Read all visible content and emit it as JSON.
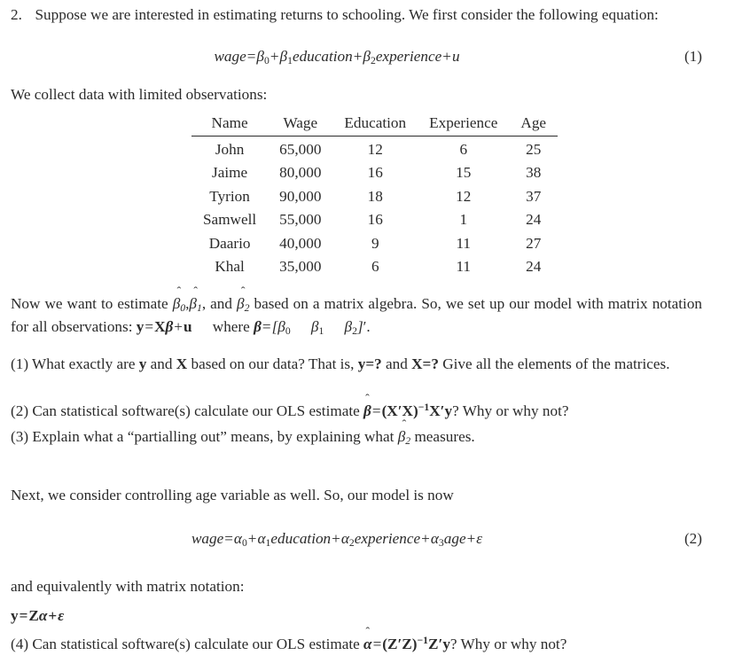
{
  "document": {
    "problem_number": "2.",
    "intro_paragraph": "Suppose we are interested in estimating returns to schooling. We first consider the following equation:",
    "collect_data_line": "We collect data with limited observations:",
    "matrix_paragraph_pre": "Now we want to estimate",
    "matrix_paragraph_mid": ", and",
    "matrix_paragraph_post": "based on a matrix algebra. So, we set up our model with matrix notation for all observations:",
    "where_label": "where",
    "next_section_line": "Next, we consider controlling age variable as well. So, our model is now",
    "matrix_notation_line": "and equivalently with matrix notation:"
  },
  "equations": {
    "eq1": {
      "number": "(1)",
      "lhs": "wage",
      "equals": "=",
      "terms": [
        "β",
        "0",
        "β",
        "1",
        "education",
        "β",
        "2",
        "experience",
        "u"
      ],
      "plain": "wage = β0 + β1education + β2experience + u"
    },
    "eq2": {
      "number": "(2)",
      "lhs": "wage",
      "equals": "=",
      "plain": "wage = α0 + α1education + α2experience + α3age + ε"
    },
    "model_matrix": {
      "plain": "y = Xβ + u",
      "beta_def": "β=[β0 β1 β2]′"
    },
    "model_matrix_z": {
      "plain": "y = Zα + ε"
    }
  },
  "table": {
    "columns": [
      "Name",
      "Wage",
      "Education",
      "Experience",
      "Age"
    ],
    "rows": [
      {
        "name": "John",
        "wage": "65,000",
        "education": "12",
        "experience": "6",
        "age": "25"
      },
      {
        "name": "Jaime",
        "wage": "80,000",
        "education": "16",
        "experience": "15",
        "age": "38"
      },
      {
        "name": "Tyrion",
        "wage": "90,000",
        "education": "18",
        "experience": "12",
        "age": "37"
      },
      {
        "name": "Samwell",
        "wage": "55,000",
        "education": "16",
        "experience": "1",
        "age": "24"
      },
      {
        "name": "Daario",
        "wage": "40,000",
        "education": "9",
        "experience": "11",
        "age": "27"
      },
      {
        "name": "Khal",
        "wage": "35,000",
        "education": "6",
        "experience": "11",
        "age": "24"
      }
    ]
  },
  "questions": [
    {
      "label": "(1)",
      "text_a": "What exactly are",
      "text_b": "and",
      "text_c": "based on our data? That is,",
      "text_d": "y=?",
      "text_e": "and",
      "text_f": "X=?",
      "text_g": "Give all the elements of the matrices.",
      "plain": "(1) What exactly are y and X based on our data? That is, y=? and X=? Give all the elements of the matrices."
    },
    {
      "label": "(2)",
      "text_a": "Can statistical software(s) calculate our OLS estimate",
      "formula": "β̂=(X′X)⁻¹X′y?",
      "text_b": "Why or why not?",
      "plain": "(2) Can statistical software(s) calculate our OLS estimate β̂=(X′X)⁻¹X′y? Why or why not?"
    },
    {
      "label": "(3)",
      "text_a": "Explain what a “partialling out” means, by explaining what",
      "text_b": "measures.",
      "plain": "(3) Explain what a “partialling out” means, by explaining what β̂2 measures."
    },
    {
      "label": "(4)",
      "text_a": "Can statistical software(s) calculate our OLS estimate",
      "formula": "α̂=(Z′Z)⁻¹Z′y?",
      "text_b": "Why or why not?",
      "plain": "(4) Can statistical software(s) calculate our OLS estimate α̂=(Z′Z)⁻¹Z′y? Why or why not?"
    }
  ],
  "symbols": {
    "beta": "β",
    "alpha": "α",
    "epsilon": "ε",
    "hat": "ˆ",
    "prime": "′",
    "minus_one": "−1"
  },
  "colors": {
    "text": "#2b2b2b",
    "background": "#ffffff",
    "rule": "#2b2b2b"
  }
}
